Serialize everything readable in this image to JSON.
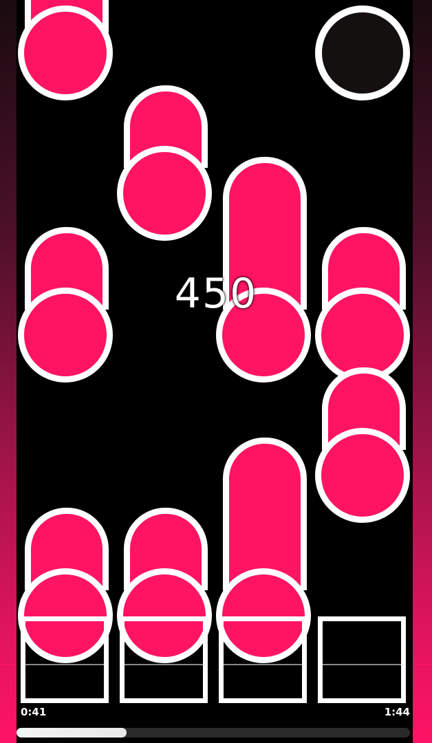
{
  "score": "450",
  "progress": {
    "elapsed": "0:41",
    "total": "1:44",
    "fraction": 0.28
  },
  "colors": {
    "note": "#ff1464",
    "outline": "#ffffff",
    "background": "#000000",
    "side_glow": "#ff1464",
    "dark_note": "#141010"
  },
  "lanes": 4,
  "keys": [
    "lane-1-key",
    "lane-2-key",
    "lane-3-key",
    "lane-4-key"
  ]
}
